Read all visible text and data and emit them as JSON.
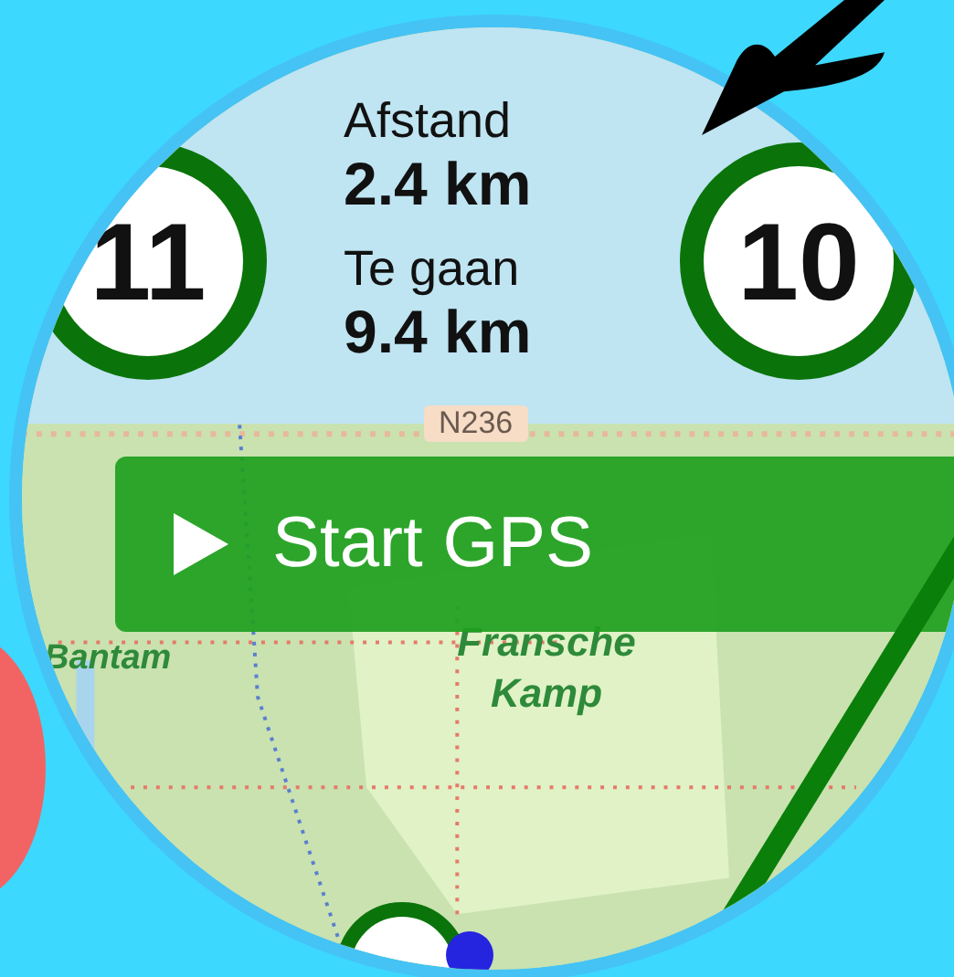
{
  "waypoints": [
    {
      "label": "11"
    },
    {
      "label": "10"
    }
  ],
  "stats": [
    {
      "label": "Afstand",
      "value": "2.4 km"
    },
    {
      "label": "Te gaan",
      "value": "9.4 km"
    }
  ],
  "map": {
    "road_label": "N236",
    "places": [
      {
        "name": "Bantam",
        "kind": "village"
      },
      {
        "name": "Fransche Kamp",
        "kind": "area"
      }
    ]
  },
  "start_button": {
    "label": "Start GPS"
  }
}
